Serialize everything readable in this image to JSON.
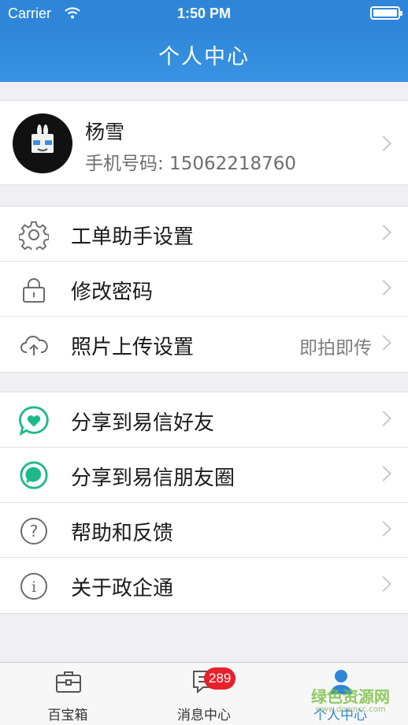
{
  "status_bar": {
    "carrier": "Carrier",
    "time": "1:50 PM"
  },
  "nav": {
    "title": "个人中心"
  },
  "profile": {
    "name": "杨雪",
    "phone": "手机号码: 15062218760"
  },
  "settings": [
    {
      "label": "工单助手设置",
      "icon": "gear-icon"
    },
    {
      "label": "修改密码",
      "icon": "lock-icon"
    },
    {
      "label": "照片上传设置",
      "value": "即拍即传",
      "icon": "cloud-upload-icon"
    }
  ],
  "more": [
    {
      "label": "分享到易信好友",
      "icon": "yixin-chat-icon"
    },
    {
      "label": "分享到易信朋友圈",
      "icon": "yixin-moments-icon"
    },
    {
      "label": "帮助和反馈",
      "icon": "help-icon"
    },
    {
      "label": "关于政企通",
      "icon": "info-icon"
    }
  ],
  "tabs": [
    {
      "label": "百宝箱",
      "icon": "toolbox-icon"
    },
    {
      "label": "消息中心",
      "icon": "message-icon",
      "badge": "289"
    },
    {
      "label": "个人中心",
      "icon": "person-icon",
      "active": true
    }
  ],
  "watermark": {
    "text": "绿色资源网",
    "sub": "www.downcc.com"
  },
  "colors": {
    "primary": "#2f86d8",
    "badge": "#e8202b",
    "yixin": "#1eb98a"
  }
}
